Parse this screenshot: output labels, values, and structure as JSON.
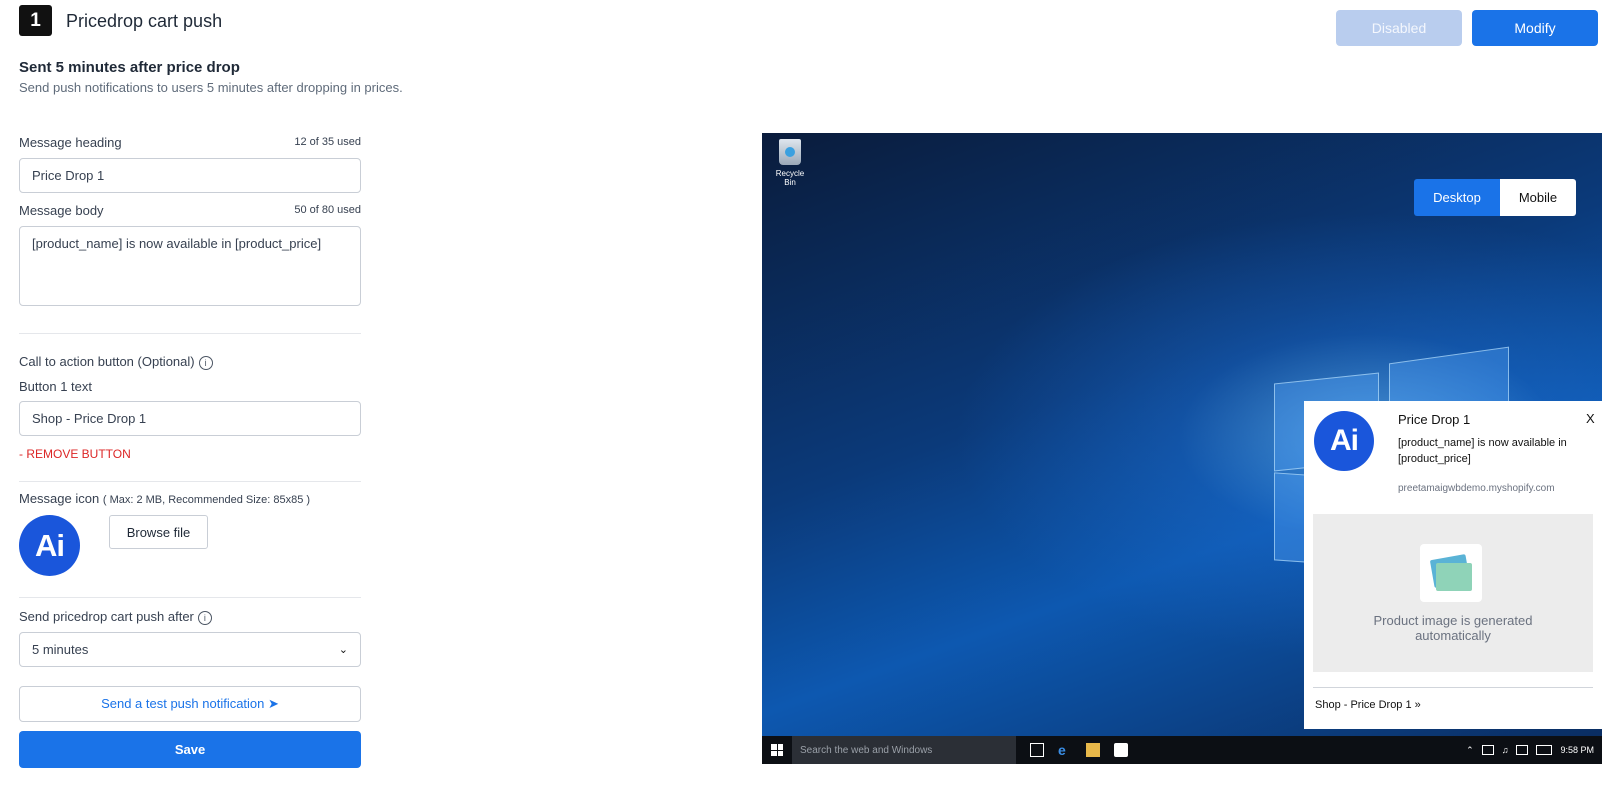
{
  "header": {
    "step_number": "1",
    "title": "Pricedrop cart push",
    "disabled_label": "Disabled",
    "modify_label": "Modify"
  },
  "section": {
    "title": "Sent 5 minutes after price drop",
    "description": "Send push notifications to users 5 minutes after dropping in prices."
  },
  "form": {
    "heading_label": "Message heading",
    "heading_counter": "12 of 35 used",
    "heading_value": "Price Drop 1",
    "body_label": "Message body",
    "body_counter": "50 of 80 used",
    "body_value": "[product_name] is now available in [product_price]",
    "cta_label": "Call to action button (Optional)",
    "button1_label": "Button 1 text",
    "button1_value": "Shop - Price Drop 1",
    "remove_button": "- REMOVE BUTTON",
    "icon_label": "Message icon",
    "icon_note": "( Max: 2 MB, Recommended Size: 85x85 )",
    "icon_text": "Ai",
    "browse_label": "Browse file",
    "send_after_label": "Send pricedrop cart push after",
    "send_after_value": "5 minutes",
    "test_label": "Send a test push notification",
    "save_label": "Save"
  },
  "preview": {
    "recycle_bin": "Recycle Bin",
    "desktop_label": "Desktop",
    "mobile_label": "Mobile",
    "notification": {
      "icon_text": "Ai",
      "title": "Price Drop 1",
      "close": "X",
      "body": "[product_name] is now available in [product_price]",
      "domain": "preetamaigwbdemo.myshopify.com",
      "image_text": "Product image is generated automatically",
      "cta": "Shop - Price Drop 1"
    },
    "taskbar": {
      "search_placeholder": "Search the web and Windows",
      "time": "9:58 PM"
    }
  },
  "colors": {
    "primary": "#1a73e8",
    "disabled": "#b9cdee",
    "danger": "#dc2626",
    "logo": "#1a56db"
  }
}
